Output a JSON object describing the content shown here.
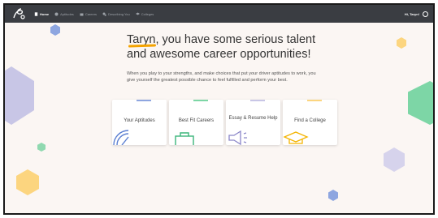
{
  "header": {
    "nav": [
      {
        "label": "Home",
        "active": true,
        "icon": "document-icon"
      },
      {
        "label": "Aptitudes",
        "active": false,
        "icon": "aptitudes-icon"
      },
      {
        "label": "Careers",
        "active": false,
        "icon": "careers-icon"
      },
      {
        "label": "Describing You",
        "active": false,
        "icon": "describing-icon"
      },
      {
        "label": "Colleges",
        "active": false,
        "icon": "colleges-icon"
      }
    ],
    "greeting": "Hi, Taryn!"
  },
  "hero": {
    "title_line1": "Taryn, you have some serious talent",
    "title_line2": "and awesome career opportunities!",
    "body": "When you play to your strengths, and make choices that put your driver aptitudes to work, you give yourself the greatest possible chance to feel fulfilled and perform your best."
  },
  "cards": [
    {
      "label": "Your Aptitudes",
      "icon": "gauge-icon"
    },
    {
      "label": "Best Fit Careers",
      "icon": "briefcase-icon"
    },
    {
      "label": "Essay & Resume Help",
      "icon": "megaphone-icon"
    },
    {
      "label": "Find a College",
      "icon": "graduation-cap-icon"
    }
  ],
  "colors": {
    "topbar": "#3a3d42",
    "background": "#fbf6f3",
    "accent_orange": "#f4a300",
    "hex_purple": "#c8c6e6",
    "hex_green": "#7dd6a6",
    "hex_yellow": "#fcd57f",
    "hex_blue": "#8ea6e0"
  }
}
